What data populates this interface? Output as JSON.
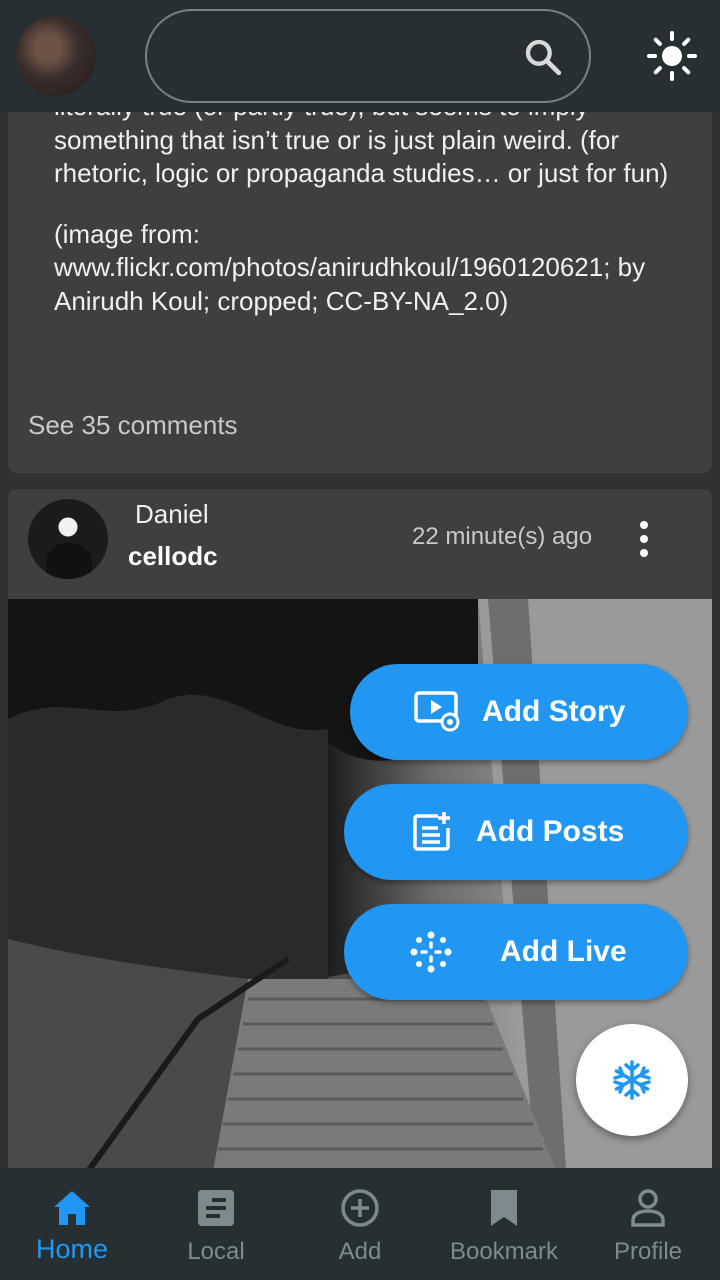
{
  "colors": {
    "accent": "#2196f3",
    "topbar_bg": "#263033",
    "card_bg": "#3e3f41",
    "page_bg": "#2f3133",
    "inactive_nav": "#7f8a8e"
  },
  "topbar": {
    "search_placeholder": "",
    "search_icon": "search-icon",
    "theme_icon": "sun-icon"
  },
  "first_post": {
    "text_line_partial": "literally true (or partly true), but seems to imply",
    "text_para1": "something that isn’t true or is just plain weird. (for rhetoric, logic or propaganda studies… or just for fun)",
    "text_para2": "(image from: www.flickr.com/photos/anirudhkoul/1960120621; by Anirudh Koul; cropped; CC-BY-NA_2.0)",
    "comments_link": "See 35 comments"
  },
  "second_post": {
    "display_name": "Daniel",
    "username": "cellodc",
    "timestamp": "22 minute(s) ago"
  },
  "fab_menu": {
    "story_label": "Add Story",
    "posts_label": "Add Posts",
    "live_label": "Add Live",
    "main_icon": "snowflake-icon"
  },
  "bottom_nav": {
    "home": "Home",
    "local": "Local",
    "add": "Add",
    "bookmark": "Bookmark",
    "profile": "Profile",
    "active": "Home"
  }
}
